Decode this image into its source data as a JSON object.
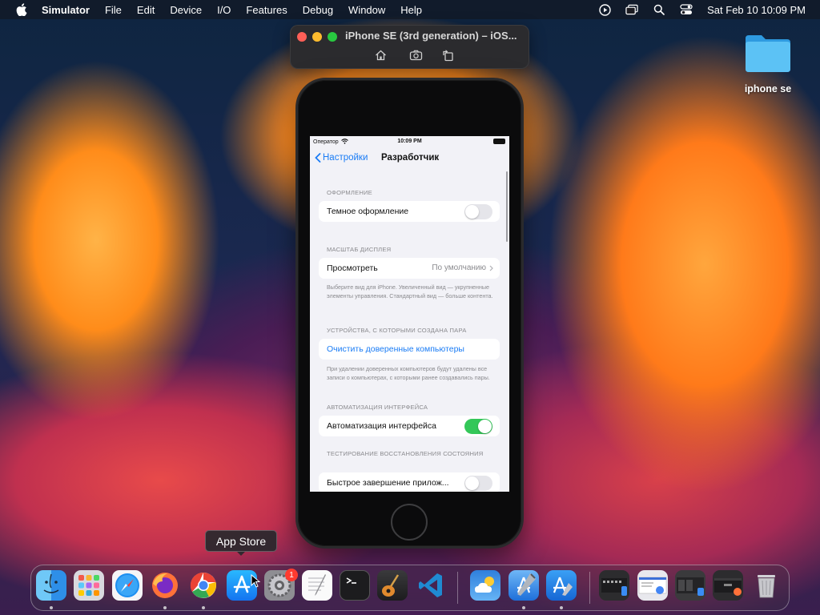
{
  "menubar": {
    "app_name": "Simulator",
    "items": [
      "File",
      "Edit",
      "Device",
      "I/O",
      "Features",
      "Debug",
      "Window",
      "Help"
    ],
    "clock": "Sat Feb 10  10:09 PM"
  },
  "simulator": {
    "title": "iPhone SE (3rd generation) – iOS..."
  },
  "ios": {
    "carrier": "Оператор",
    "time": "10:09 PM",
    "back_label": "Настройки",
    "title": "Разработчик",
    "sections": {
      "appearance_header": "ОФОРМЛЕНИЕ",
      "dark_mode_label": "Темное оформление",
      "display_zoom_header": "МАСШТАБ ДИСПЛЕЯ",
      "view_label": "Просмотреть",
      "view_value": "По умолчанию",
      "display_zoom_footer": "Выберите вид для iPhone. Увеличенный вид — укрупненные элементы управления. Стандартный вид — больше контента.",
      "paired_devices_header": "УСТРОЙСТВА, С КОТОРЫМИ СОЗДАНА ПАРА",
      "clear_trusted_label": "Очистить доверенные компьютеры",
      "paired_devices_footer": "При удалении доверенных компьютеров будут удалены все записи о компьютерах, с которыми ранее создавались пары.",
      "ui_automation_header": "АВТОМАТИЗАЦИЯ ИНТЕРФЕЙСА",
      "ui_automation_label": "Автоматизация интерфейса",
      "state_restoration_header": "ТЕСТИРОВАНИЕ ВОССТАНОВЛЕНИЯ СОСТОЯНИЯ",
      "fast_app_termination_label": "Быстрое завершение прилож..."
    },
    "toggles": {
      "dark_mode": false,
      "ui_automation": true,
      "fast_app_termination": false
    },
    "colors": {
      "accent": "#1a7cf5",
      "toggle_on": "#34c759"
    }
  },
  "desktop": {
    "folder_label": "iphone se"
  },
  "dock": {
    "tooltip": "App Store",
    "settings_badge": "1",
    "apps": [
      "Finder",
      "Launchpad",
      "Safari",
      "Firefox",
      "Chrome",
      "App Store",
      "System Settings",
      "TextEdit",
      "Terminal",
      "Instruments",
      "Visual Studio Code",
      "Weather",
      "Xcode",
      "Simulator"
    ]
  }
}
